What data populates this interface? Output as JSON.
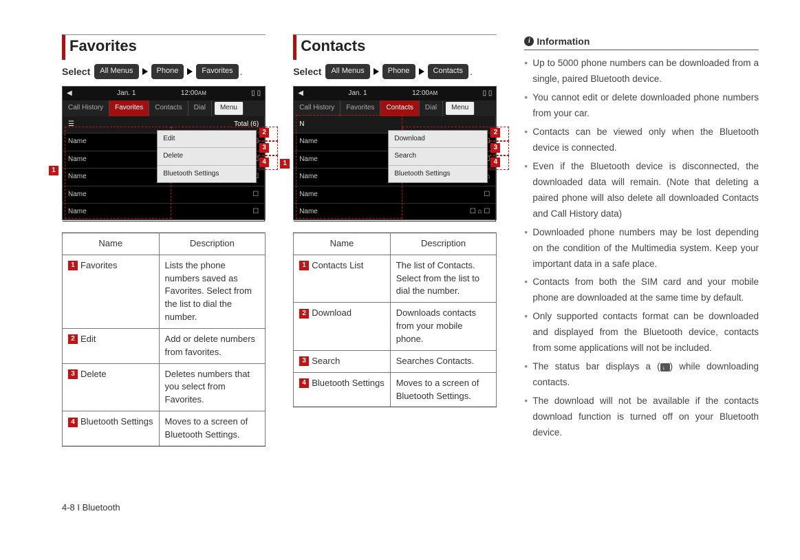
{
  "favorites": {
    "title": "Favorites",
    "select_label": "Select",
    "path": [
      "All Menus",
      "Phone",
      "Favorites"
    ],
    "screenshot": {
      "date": "Jan. 1",
      "time": "12:00",
      "time_suffix": "AM",
      "tabs": [
        "Call History",
        "Favorites",
        "Contacts",
        "Dial"
      ],
      "active_tab": "Favorites",
      "menu_label": "Menu",
      "header_row": "Total (6)",
      "list_rows": [
        "Name",
        "Name",
        "Name",
        "Name",
        "Name"
      ],
      "popup": [
        "Edit",
        "Delete",
        "Bluetooth Settings"
      ]
    },
    "table": {
      "headers": [
        "Name",
        "Description"
      ],
      "rows": [
        {
          "num": "1",
          "name": "Favorites",
          "desc": "Lists the phone numbers saved as Favorites. Select from the list to dial the number."
        },
        {
          "num": "2",
          "name": "Edit",
          "desc": "Add or delete numbers from favorites."
        },
        {
          "num": "3",
          "name": "Delete",
          "desc": "Deletes numbers that you select from Favorites."
        },
        {
          "num": "4",
          "name": "Bluetooth Settings",
          "desc": "Moves to a screen of Bluetooth Settings."
        }
      ]
    }
  },
  "contacts": {
    "title": "Contacts",
    "select_label": "Select",
    "path": [
      "All Menus",
      "Phone",
      "Contacts"
    ],
    "screenshot": {
      "date": "Jan. 1",
      "time": "12:00",
      "time_suffix": "AM",
      "tabs": [
        "Call History",
        "Favorites",
        "Contacts",
        "Dial"
      ],
      "active_tab": "Contacts",
      "menu_label": "Menu",
      "header_row": "N",
      "list_rows": [
        "Name",
        "Name",
        "Name",
        "Name",
        "Name"
      ],
      "popup": [
        "Download",
        "Search",
        "Bluetooth Settings"
      ]
    },
    "table": {
      "headers": [
        "Name",
        "Description"
      ],
      "rows": [
        {
          "num": "1",
          "name": "Contacts List",
          "desc": "The list of Contacts. Select from the list to dial the number."
        },
        {
          "num": "2",
          "name": "Download",
          "desc": "Downloads contacts from your mobile phone."
        },
        {
          "num": "3",
          "name": "Search",
          "desc": "Searches Contacts."
        },
        {
          "num": "4",
          "name": "Bluetooth Settings",
          "desc": "Moves to a screen of Bluetooth Settings."
        }
      ]
    }
  },
  "information": {
    "heading": "Information",
    "items": [
      "Up to 5000 phone numbers can be downloaded from a single, paired Bluetooth device.",
      "You cannot edit or delete downloaded phone numbers from your car.",
      "Contacts can be viewed only when the Bluetooth device is connected.",
      "Even if the Bluetooth device is disconnected, the downloaded data will remain. (Note that deleting a paired phone will also delete all downloaded Contacts and Call History data)",
      "Downloaded phone numbers may be lost depending on the condition of the Multimedia system. Keep your important data in a safe place.",
      "Contacts from both the SIM card and your mobile phone are downloaded at the same time by default.",
      "Only supported contacts format can be downloaded and displayed from the Bluetooth device, contacts from some applications will not be included.",
      "The status bar displays a ( ⬇ ) while downloading contacts.",
      "The download will not be available if the contacts download function is turned off on your Bluetooth device."
    ]
  },
  "footer": "4-8 I Bluetooth"
}
